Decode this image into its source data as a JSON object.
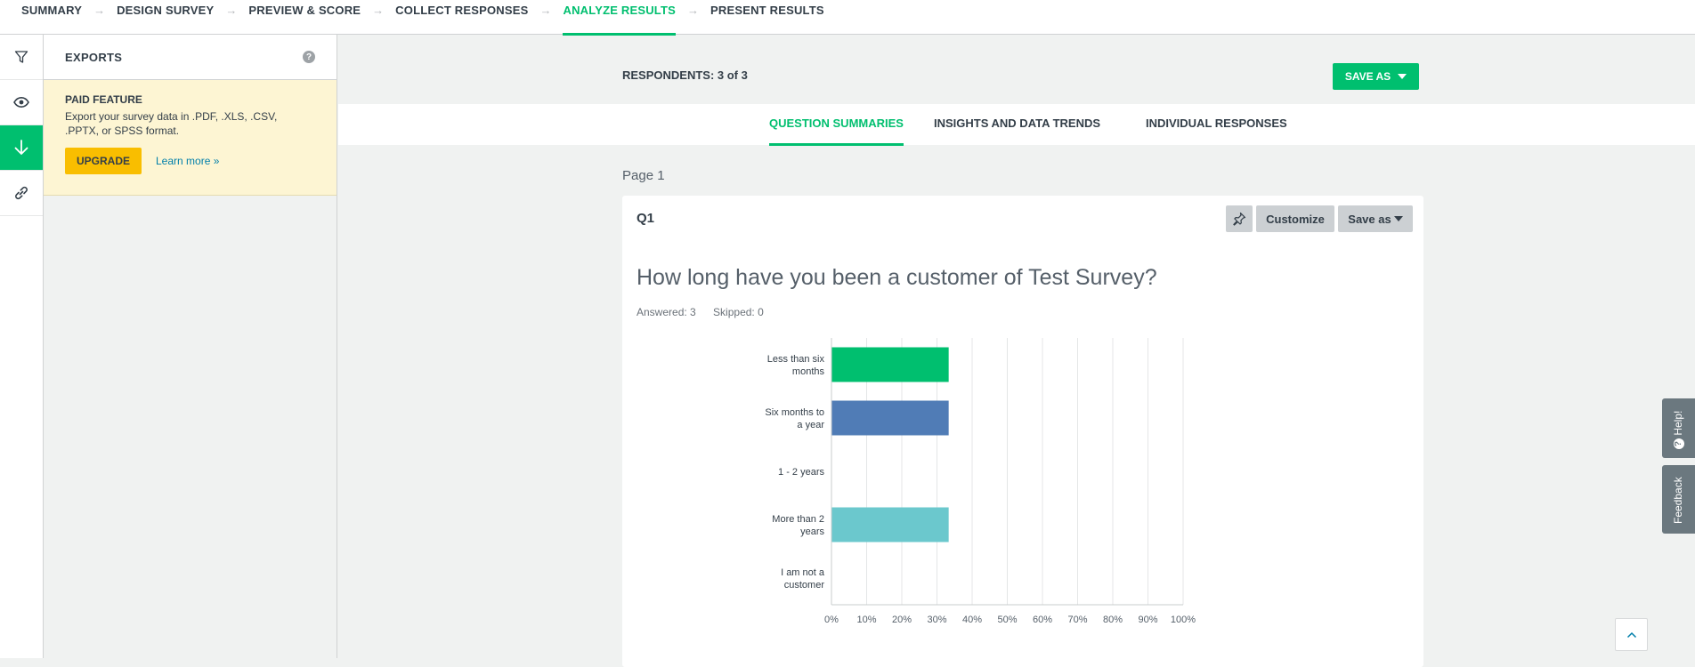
{
  "steps": [
    "SUMMARY",
    "DESIGN SURVEY",
    "PREVIEW & SCORE",
    "COLLECT RESPONSES",
    "ANALYZE RESULTS",
    "PRESENT RESULTS"
  ],
  "active_step": "ANALYZE RESULTS",
  "rail": {
    "items": [
      {
        "icon": "filter-icon",
        "active": false
      },
      {
        "icon": "eye-icon",
        "active": false
      },
      {
        "icon": "download-arrow-icon",
        "active": true
      },
      {
        "icon": "link-icon",
        "active": false
      }
    ]
  },
  "panel": {
    "title": "EXPORTS",
    "help_glyph": "?",
    "paid_title": "PAID FEATURE",
    "paid_text": "Export your survey data in .PDF, .XLS, .CSV, .PPTX, or SPSS format.",
    "upgrade_label": "UPGRADE",
    "learn_more": "Learn more »"
  },
  "main": {
    "respondents": "RESPONDENTS: 3 of 3",
    "save_as": "SAVE AS",
    "tabs": [
      "QUESTION SUMMARIES",
      "INSIGHTS AND DATA TRENDS",
      "INDIVIDUAL RESPONSES"
    ],
    "active_tab": "QUESTION SUMMARIES",
    "page_label": "Page 1"
  },
  "question": {
    "number": "Q1",
    "customize": "Customize",
    "save_as": "Save as",
    "text": "How long have you been a customer of Test Survey?",
    "answered": "Answered: 3",
    "skipped": "Skipped: 0"
  },
  "chart_data": {
    "type": "bar",
    "orientation": "horizontal",
    "categories": [
      [
        "Less than six",
        "months"
      ],
      [
        "Six months to",
        "a year"
      ],
      [
        "1 - 2 years"
      ],
      [
        "More than 2",
        "years"
      ],
      [
        "I am not a",
        "customer"
      ]
    ],
    "values": [
      33.33,
      33.33,
      0,
      33.33,
      0
    ],
    "colors": [
      "#00bf6f",
      "#507cb6",
      "#f9be00",
      "#6bc8cd",
      "#ff8b4f"
    ],
    "xticks": [
      "0%",
      "10%",
      "20%",
      "30%",
      "40%",
      "50%",
      "60%",
      "70%",
      "80%",
      "90%",
      "100%"
    ],
    "xlim": [
      0,
      100
    ],
    "grid": true
  },
  "floating": {
    "help": "Help!",
    "feedback": "Feedback",
    "help_glyph": "?"
  }
}
